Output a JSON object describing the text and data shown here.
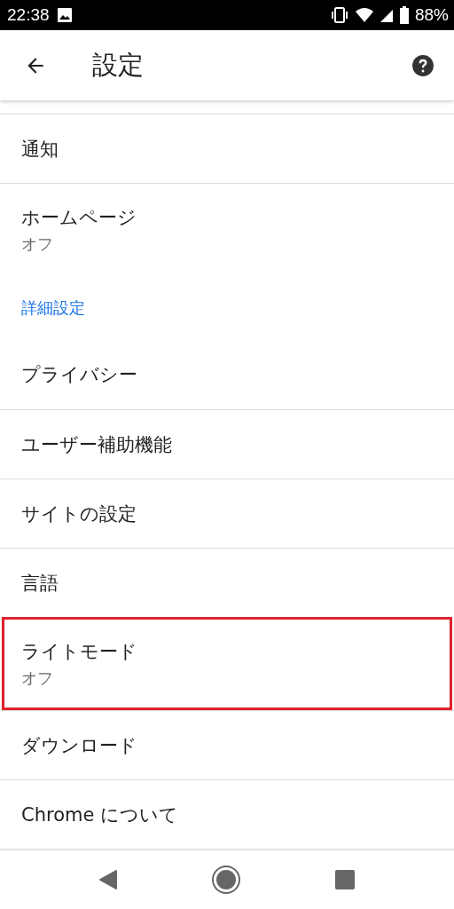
{
  "status_bar": {
    "time": "22:38",
    "battery": "88%"
  },
  "app_bar": {
    "title": "設定"
  },
  "items": [
    {
      "kind": "item",
      "title": "通知",
      "highlighted": false
    },
    {
      "kind": "item",
      "title": "ホームページ",
      "subtitle": "オフ",
      "highlighted": false
    },
    {
      "kind": "header",
      "title": "詳細設定"
    },
    {
      "kind": "item",
      "title": "プライバシー",
      "highlighted": false
    },
    {
      "kind": "item",
      "title": "ユーザー補助機能",
      "highlighted": false
    },
    {
      "kind": "item",
      "title": "サイトの設定",
      "highlighted": false
    },
    {
      "kind": "item",
      "title": "言語",
      "highlighted": false
    },
    {
      "kind": "item",
      "title": "ライトモード",
      "subtitle": "オフ",
      "highlighted": true
    },
    {
      "kind": "item",
      "title": "ダウンロード",
      "highlighted": false
    },
    {
      "kind": "item",
      "title": "Chrome について",
      "highlighted": false
    }
  ]
}
